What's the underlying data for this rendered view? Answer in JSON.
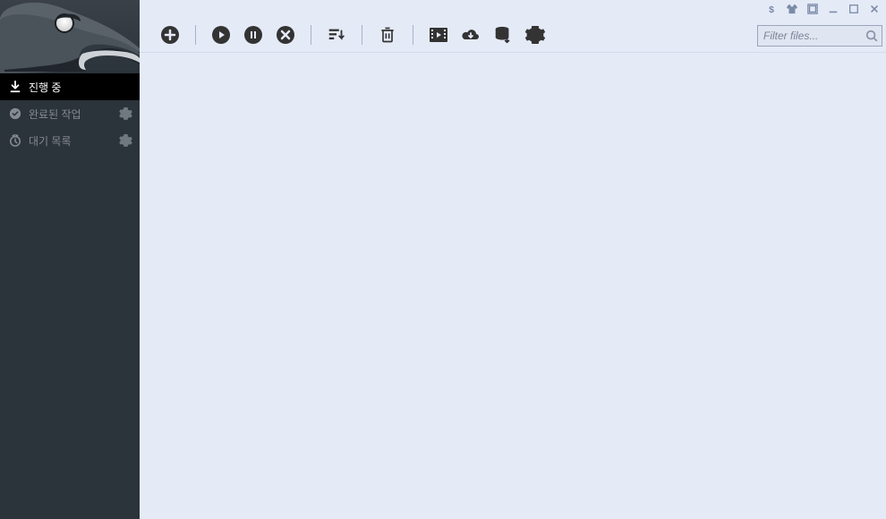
{
  "sidebar": {
    "items": [
      {
        "label": "진행 중",
        "icon": "download"
      },
      {
        "label": "완료된 작업",
        "icon": "check-circle"
      },
      {
        "label": "대기 목록",
        "icon": "clock"
      }
    ]
  },
  "search": {
    "placeholder": "Filter files..."
  },
  "colors": {
    "sidebar_bg": "#2b333b",
    "main_bg": "#e4eaf6",
    "toolbar_icon": "#333333",
    "sidebar_text": "#858b91",
    "sidebar_active_bg": "#000000",
    "sidebar_active_text": "#ffffff"
  }
}
